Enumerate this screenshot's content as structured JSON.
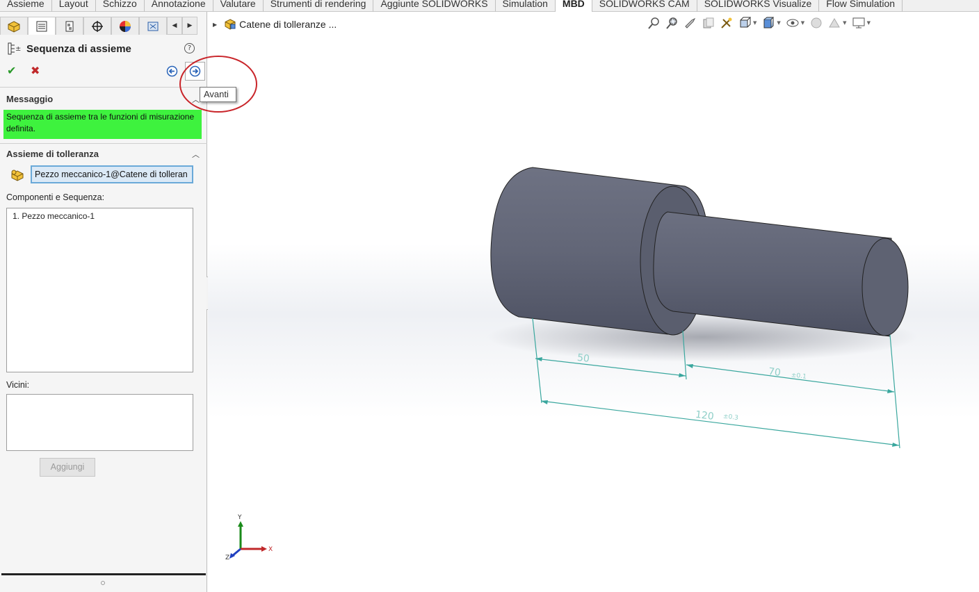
{
  "ribbon": {
    "tabs": [
      "Assieme",
      "Layout",
      "Schizzo",
      "Annotazione",
      "Valutare",
      "Strumenti di rendering",
      "Aggiunte SOLIDWORKS",
      "Simulation",
      "MBD",
      "SOLIDWORKS CAM",
      "SOLIDWORKS Visualize",
      "Flow Simulation"
    ],
    "active": "MBD"
  },
  "manager_tabs": [
    "feature-manager-icon",
    "property-manager-icon",
    "configuration-manager-icon",
    "dimxpert-icon",
    "display-manager-icon",
    "cam-manager-icon"
  ],
  "property_manager": {
    "title": "Sequenza di assieme",
    "help": "?",
    "message_header": "Messaggio",
    "message_text": "Sequenza di assieme tra le funzioni di misurazione definita.",
    "tol_assembly_header": "Assieme di tolleranza",
    "selected_component": "Pezzo meccanico-1@Catene di tolleran",
    "components_label": "Componenti e Sequenza:",
    "components": [
      "1. Pezzo meccanico-1"
    ],
    "neighbors_label": "Vicini:",
    "neighbors": [],
    "add_button": "Aggiungi"
  },
  "tooltip": "Avanti",
  "breadcrumb": "Catene di tolleranze ...",
  "model": {
    "dim_small": "50",
    "dim_large": "70",
    "dim_large_tol": "±0.1",
    "dim_total": "120",
    "dim_total_tol": "±0.3"
  },
  "triad": {
    "x": "X",
    "y": "Y",
    "z": "Z"
  },
  "colors": {
    "message_bg": "#3ef23e",
    "dimension": "#3aa79e",
    "highlight_circle": "#c9252a",
    "model_body": "#676b7c"
  }
}
